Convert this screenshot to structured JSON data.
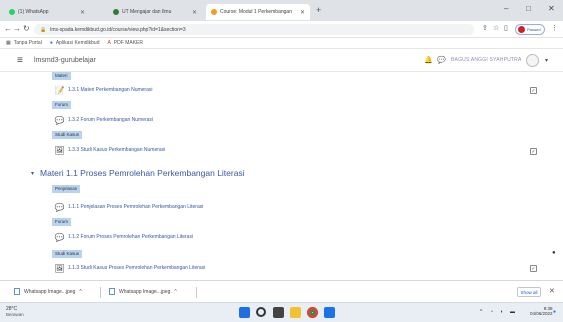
{
  "browser": {
    "tabs": [
      {
        "title": "(1) WhatsApp",
        "favicon_color": "#25d366",
        "active": false
      },
      {
        "title": "UT Mengajar dan Ilmu",
        "favicon_color": "#2e7d32",
        "active": false
      },
      {
        "title": "Course: Modul 1 Perkembangan",
        "favicon_color": "#f59a23",
        "active": true
      }
    ],
    "new_tab_label": "+",
    "window_controls": {
      "minimize": "–",
      "maximize": "□",
      "close": "✕"
    },
    "url": "lms-spada.kemdikbud.go.id/course/view.php?id=1&section=3",
    "profile_label": "Paused",
    "bookmarks": [
      {
        "label": "Tanpa Portal"
      },
      {
        "label": "Aplikasi Kemdikbud"
      },
      {
        "label": "PDF MAKER"
      }
    ]
  },
  "moodle": {
    "site_name": "lmsmd3-gurubelajar",
    "user_name": "BAGUS ANGGI SYAHPUTRA",
    "sections": [
      {
        "groups": [
          {
            "label": "Materi",
            "activities": [
              {
                "title": "1.3.1 Materi Perkembangan Numerasi",
                "icon": "📝"
              }
            ]
          },
          {
            "label": "Forum",
            "activities": [
              {
                "title": "1.3.2 Forum Perkembangan Numerasi",
                "icon": "💬"
              }
            ]
          },
          {
            "label": "Studi Kasus",
            "activities": [
              {
                "title": "1.3.3 Studi Kasus Perkembangan Numerasi",
                "icon": "🖼"
              }
            ]
          }
        ]
      },
      {
        "title": "Materi 1.1 Proses Pemrolehan Perkembangan Literasi",
        "groups": [
          {
            "label": "Penjelasan",
            "activities": [
              {
                "title": "1.1.1 Penjelasan Proses Pemrolehan Perkembangan Literasi",
                "icon": "💬"
              }
            ]
          },
          {
            "label": "Forum",
            "activities": [
              {
                "title": "1.1.2 Forum Proses Pemrolehan Perkembangan Literasi",
                "icon": "💬"
              }
            ]
          },
          {
            "label": "Studi Kasus",
            "activities": [
              {
                "title": "1.1.3 Studi Kasus Proses Pemrolehan Perkembangan Literasi",
                "icon": "🖼"
              }
            ]
          }
        ]
      }
    ],
    "completion_mark": "✓"
  },
  "downloads": {
    "items": [
      {
        "label": "Whatsapp Image...jpeg"
      },
      {
        "label": "Whatsapp Image...jpeg"
      }
    ],
    "show_all_label": "Show all"
  },
  "taskbar": {
    "weather_temp": "28°C",
    "weather_desc": "Berawan",
    "clock_time": "9:38",
    "clock_date": "04/06/2022"
  }
}
